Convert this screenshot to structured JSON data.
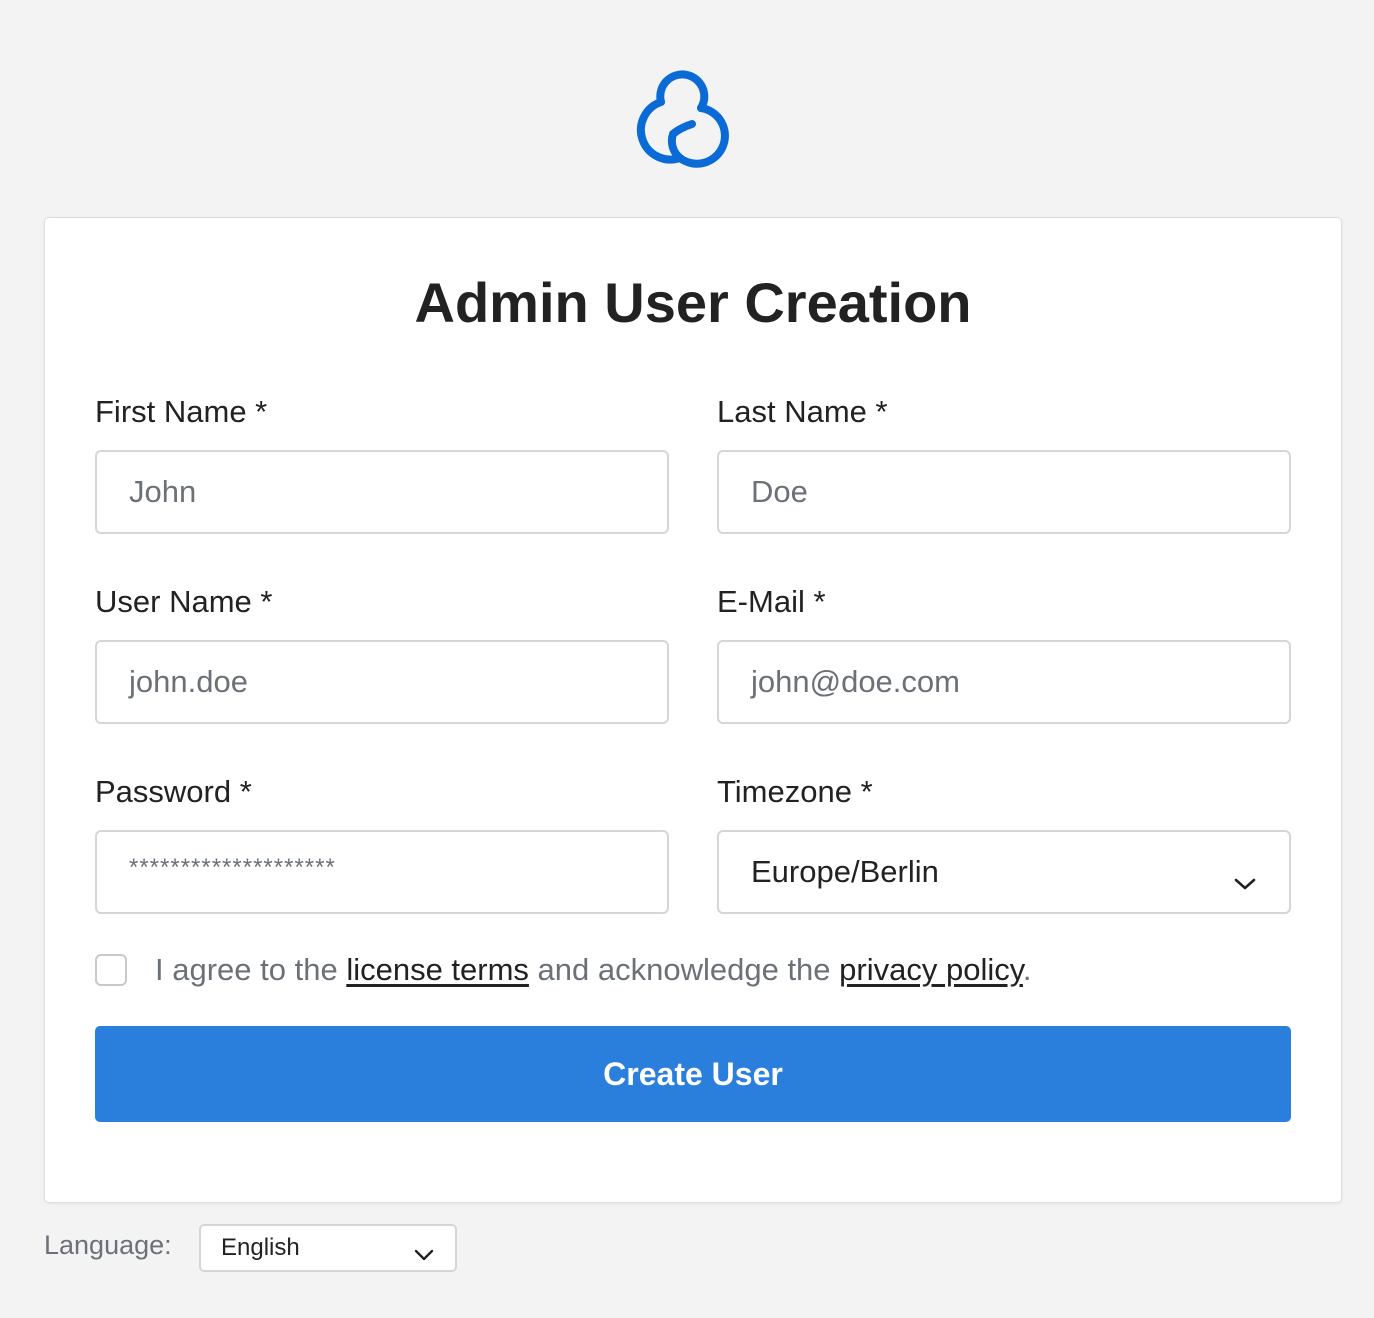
{
  "brand": {
    "logo_icon": "cloud-logo-icon",
    "accent_color": "#2a7fdc",
    "logo_color": "#0b6bd6"
  },
  "form": {
    "title": "Admin User Creation",
    "fields": {
      "first_name": {
        "label": "First Name *",
        "placeholder": "John"
      },
      "last_name": {
        "label": "Last Name *",
        "placeholder": "Doe"
      },
      "user_name": {
        "label": "User Name *",
        "placeholder": "john.doe"
      },
      "email": {
        "label": "E-Mail *",
        "placeholder": "john@doe.com"
      },
      "password": {
        "label": "Password *",
        "value": "********************"
      },
      "timezone": {
        "label": "Timezone *",
        "value": "Europe/Berlin",
        "icon": "chevron-down-icon"
      }
    },
    "agreement": {
      "checked": false,
      "text_before": "I agree to the ",
      "license_link": "license terms",
      "text_middle": " and acknowledge the ",
      "privacy_link": "privacy policy",
      "text_after": "."
    },
    "submit_label": "Create User"
  },
  "footer": {
    "language_label": "Language:",
    "language_value": "English",
    "language_icon": "chevron-down-icon"
  }
}
